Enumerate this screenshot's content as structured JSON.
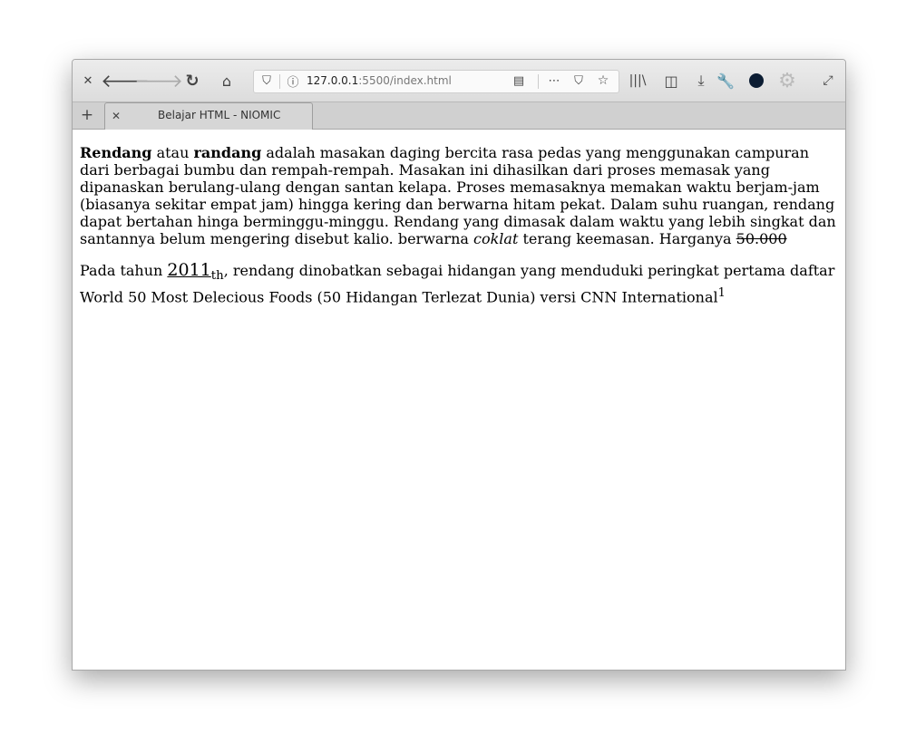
{
  "browser": {
    "url_host": "127.0.0.1",
    "url_rest": ":5500/index.html",
    "tab_title": "Belajar HTML - NIOMIC",
    "accent_profile": "#0c1d33"
  },
  "article": {
    "p1": {
      "b1": "Rendang",
      "t1": " atau ",
      "b2": "randang",
      "t2": " adalah masakan daging bercita rasa pedas yang menggunakan campuran dari berbagai bumbu dan rempah-rempah. Masakan ini dihasilkan dari proses memasak yang dipanaskan berulang-ulang dengan santan kelapa. Proses memasaknya memakan waktu berjam-jam (biasanya sekitar empat jam) hingga kering dan berwarna hitam pekat. Dalam suhu ruangan, rendang dapat bertahan hinga berminggu-minggu. Rendang yang dimasak dalam waktu yang lebih singkat dan santannya belum mengering disebut kalio. berwarna ",
      "i1": "coklat",
      "t3": " terang keemasan. Harganya ",
      "del": "50.000"
    },
    "p2": {
      "t1": "Pada tahun ",
      "year": "2011",
      "sub": "th",
      "t2": ", rendang dinobatkan sebagai hidangan yang menduduki peringkat pertama daftar World 50 Most Delecious Foods (50 Hidangan Terlezat Dunia) versi CNN International",
      "sup": "1"
    }
  }
}
